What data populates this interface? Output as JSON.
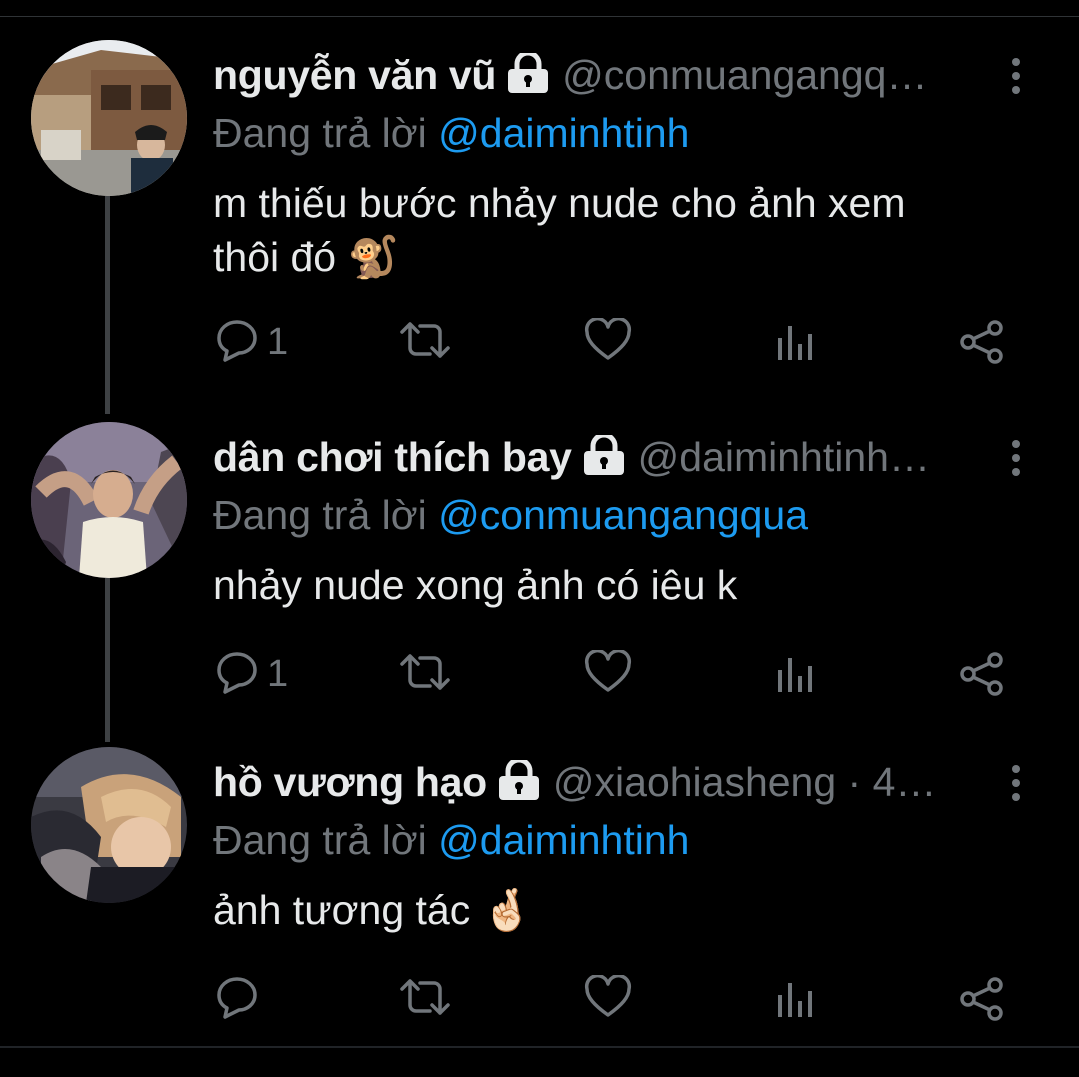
{
  "tweets": [
    {
      "name": "nguyễn văn vũ",
      "handle": "@conmuangangq…",
      "reply_prefix": "Đang trả lời ",
      "reply_mention": "@daiminhtinh",
      "text_line1": "m thiếu bước nhảy nude cho ảnh xem",
      "text_line2": "thôi đó 🐒",
      "reply_count": "1"
    },
    {
      "name": "dân chơi thích bay",
      "handle": "@daiminhtinh…",
      "reply_prefix": "Đang trả lời ",
      "reply_mention": "@conmuangangqua",
      "text_line1": "nhảy nude xong ảnh có iêu k",
      "reply_count": "1"
    },
    {
      "name": "hồ vương hạo",
      "handle": "@xiaohiasheng · 4…",
      "reply_prefix": "Đang trả lời ",
      "reply_mention": "@daiminhtinh",
      "text_line1": "ảnh tương tác 🤞🏻",
      "reply_count": ""
    }
  ],
  "colors": {
    "background": "#000000",
    "primary_text": "#e7e9ea",
    "secondary_text": "#71767b",
    "mention": "#1d9bf0"
  },
  "icons": [
    "lock-icon",
    "more-icon",
    "reply-icon",
    "retweet-icon",
    "like-icon",
    "views-icon",
    "share-icon"
  ]
}
